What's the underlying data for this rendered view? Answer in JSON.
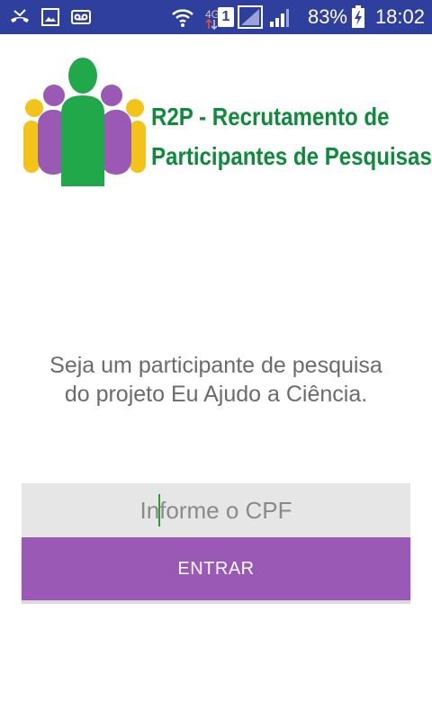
{
  "status_bar": {
    "battery_percent": "83%",
    "time": "18:02",
    "network_type": "4G",
    "sim_slot": "1",
    "icons": [
      "missed-call-icon",
      "image-icon",
      "voicemail-icon",
      "wifi-icon",
      "data-arrows-icon",
      "sim-icon",
      "signal-icon",
      "battery-charging-icon"
    ]
  },
  "logo": {
    "title_line1": "R2P - Recrutamento de",
    "title_line2": "Participantes de Pesquisas",
    "colors": {
      "green": "#21a84b",
      "purple": "#9b59b6",
      "yellow": "#f2c318",
      "title": "#0e8b3a"
    }
  },
  "intro": {
    "line1": "Seja um participante de pesquisa",
    "line2": "do projeto Eu Ajudo a Ciência."
  },
  "cpf": {
    "placeholder": "Informe o CPF",
    "value": ""
  },
  "enter_button": {
    "label": "ENTRAR",
    "color": "#9b59b6"
  },
  "theme": {
    "status_bar_bg": "#2f3f9e",
    "input_bg": "#e6e6e6"
  }
}
